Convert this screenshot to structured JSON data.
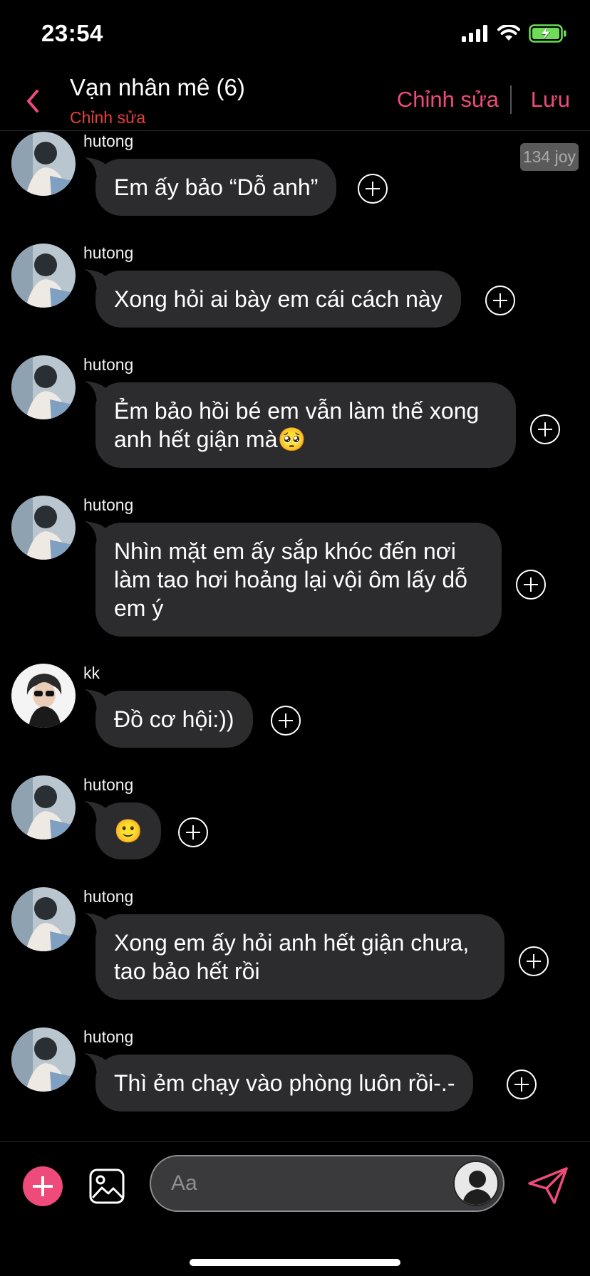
{
  "status_bar": {
    "time": "23:54"
  },
  "header": {
    "title": "Vạn nhân mê (6)",
    "subtitle": "Chỉnh sửa",
    "edit_label": "Chỉnh sửa",
    "save_label": "Lưu"
  },
  "messages": [
    {
      "sender": "hutong",
      "text": "Em ấy bảo “Dỗ anh”",
      "time_badge": "134 joy"
    },
    {
      "sender": "hutong",
      "text": "Xong hỏi ai bày em cái cách này"
    },
    {
      "sender": "hutong",
      "text": "Ẻm bảo hồi bé em vẫn làm thế xong anh hết giận mà🥺"
    },
    {
      "sender": "hutong",
      "text": "Nhìn mặt em ấy sắp khóc đến nơi làm tao hơi hoảng lại vội ôm lấy dỗ em ý"
    },
    {
      "sender": "kk",
      "text": "Đồ cơ hội:))"
    },
    {
      "sender": "hutong",
      "text": "🙂"
    },
    {
      "sender": "hutong",
      "text": "Xong em ấy hỏi anh hết giận chưa, tao bảo hết rồi"
    },
    {
      "sender": "hutong",
      "text": "Thì ẻm chạy vào phòng luôn rồi-.-"
    }
  ],
  "composer": {
    "placeholder": "Aa"
  },
  "colors": {
    "accent": "#ee4b7a",
    "subtitle": "#e8413a",
    "bubble": "#2c2c2e"
  }
}
